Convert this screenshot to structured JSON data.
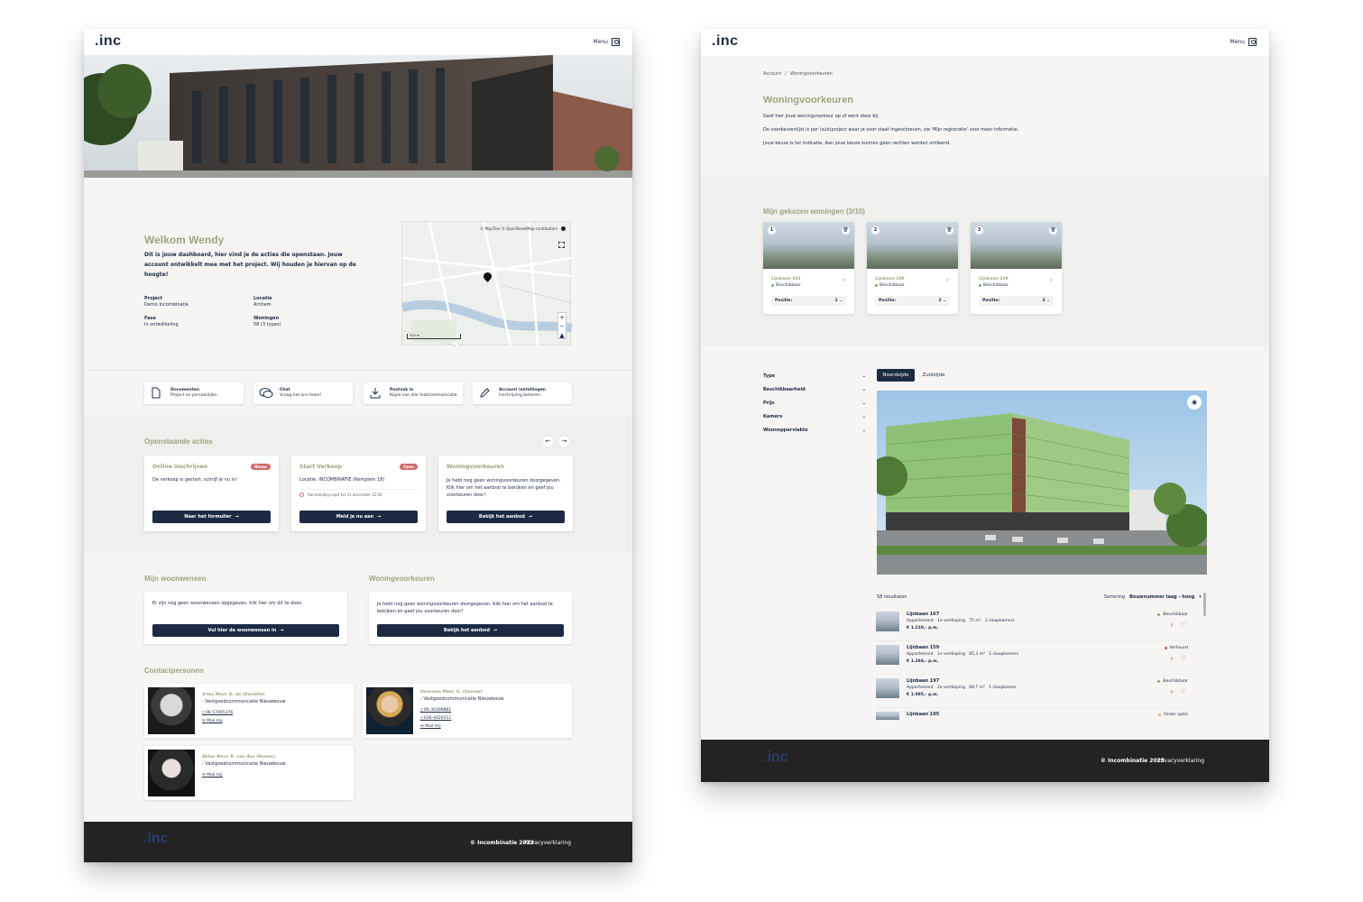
{
  "left": {
    "logo": ".inc",
    "menu_label": "Menu",
    "welcome_title": "Welkom Wendy",
    "welcome_text": "Dit is jouw dashboard, hier vind je de acties die openstaan. Jouw account ontwikkelt mee met het project. Wij houden je hiervan op de hoogte!",
    "info": [
      {
        "label": "Project",
        "value": "Demo Incombinatie"
      },
      {
        "label": "Locatie",
        "value": "Arnhem"
      },
      {
        "label": "Fase",
        "value": "In ontwikkeling"
      },
      {
        "label": "Woningen",
        "value": "58 (3 types)"
      }
    ],
    "map_attribution": "© MapTiler © OpenStreetMap contributors",
    "map_scale": "500 m",
    "quicklinks": [
      {
        "title": "Documenten",
        "sub": "Project en persoonlijke.",
        "icon": "document-icon"
      },
      {
        "title": "Chat",
        "sub": "Vraag het ons team!",
        "icon": "chat-icon"
      },
      {
        "title": "Postvak in",
        "sub": "Kopie van alle mailcommunicatie.",
        "icon": "download-icon"
      },
      {
        "title": "Account instellingen",
        "sub": "Inschrijving beheren.",
        "icon": "pencil-icon"
      }
    ],
    "open_actions_title": "Openstaande acties",
    "actions": [
      {
        "title": "Online inschrijven",
        "badge": "Nieuw",
        "text": "De verkoop is gestart, schrijf je nu in!",
        "button": "Naar het formulier"
      },
      {
        "title": "Start Verkoop",
        "badge": "Open",
        "text": "Locatie: INCOMBINATIE (Kerkplein 18)",
        "warning": "Aanmelding loopt tot 31 december 12:00",
        "button": "Meld je nu aan"
      },
      {
        "title": "Woningvoorkeuren",
        "badge": "",
        "text": "Je hebt nog geen woningvoorkeuren doorgegeven. Klik hier om het aanbod te bekijken en geef jou voorkeuren door!",
        "button": "Bekijk het aanbod"
      }
    ],
    "wishes_title": "Mijn woonwensen",
    "wishes_text": "Er zijn nog geen woonwensen opgegeven, klik hier om dit te doen.",
    "wishes_button": "Vul hier de woonwensen in",
    "prefs_title": "Woningvoorkeuren",
    "prefs_text": "Je hebt nog geen woningvoorkeuren doorgegeven. Klik hier om het aanbod te bekijken en geef jou voorkeuren door!",
    "prefs_button": "Bekijk het aanbod",
    "contacts_title": "Contactpersonen",
    "contacts": [
      {
        "name": "Vries Mevr. D. de (Daniëlle)",
        "role": "- Vastgoedcommunicatie Nieuwbouw",
        "phone": "06-57465376",
        "mail": "Mail mij"
      },
      {
        "name": "Heeroma Mevr. G. (Gonnie)",
        "role": "- Vastgoedcommunicatie Nieuwbouw",
        "phone": "06-30309881",
        "phone2": "026-4426511",
        "mail": "Mail mij"
      },
      {
        "name": "Akker Mevr. R. van den (Rowan)",
        "role": "- Vastgoedcommunicatie Nieuwbouw",
        "mail": "Mail mij"
      }
    ],
    "footer_copy": "© Incombinatie 2023",
    "footer_privacy": "Privacyverklaring"
  },
  "right": {
    "logo": ".inc",
    "menu_label": "Menu",
    "breadcrumb": [
      "Account",
      "/",
      "Woningvoorkeuren"
    ],
    "title": "Woningvoorkeuren",
    "intro": [
      "Geef hier jouw woningvoorkeur op of werk deze bij.",
      "De voorkeurenlijst is per (sub)project waar je voor staat ingeschreven, zie 'Mijn registratie' voor meer informatie.",
      "Jouw keuze is ter indicatie. Aan jouw keuze kunnen geen rechten worden ontleend."
    ],
    "chosen_title": "Mijn gekozen woningen (3/10)",
    "chosen": [
      {
        "num": "1",
        "name": "Lijnbaan 241",
        "status": "Beschikbaar",
        "pos_label": "Positie:",
        "pos": "1"
      },
      {
        "num": "2",
        "name": "Lijnbaan 109",
        "status": "Beschikbaar",
        "pos_label": "Positie:",
        "pos": "2"
      },
      {
        "num": "3",
        "name": "Lijnbaan 229",
        "status": "Beschikbaar",
        "pos_label": "Positie:",
        "pos": "3"
      }
    ],
    "filters": [
      "Type",
      "Beschikbaarheid",
      "Prijs",
      "Kamers",
      "Woonoppervlakte"
    ],
    "tabs": [
      "Noordzijde",
      "Zuidzijde"
    ],
    "results_count": "58 resultaten",
    "sort_label": "Sortering",
    "sort_value": "Bouwnummer laag - hoog",
    "listings": [
      {
        "name": "Lijnbaan 167",
        "details": "Appartement   1e verdieping   75 m²   2 slaapkamers",
        "price": "€ 1.210,- p.m.",
        "status": "Beschikbaar",
        "status_color": "#79b15f"
      },
      {
        "name": "Lijnbaan 159",
        "details": "Appartement   1e verdieping   85,3 m²   2 slaapkamers",
        "price": "€ 1.294,- p.m.",
        "status": "Verhuurd",
        "status_color": "#d9534f"
      },
      {
        "name": "Lijnbaan 197",
        "details": "Appartement   2e verdieping   68,7 m²   1 slaapkamer",
        "price": "€ 1.095,- p.m.",
        "status": "Beschikbaar",
        "status_color": "#79b15f"
      },
      {
        "name": "Lijnbaan 195",
        "details": "",
        "price": "",
        "status": "Onder optie",
        "status_color": "#e8b84a"
      }
    ],
    "footer_copy": "© Incombinatie 2023",
    "footer_privacy": "Privacyverklaring"
  }
}
